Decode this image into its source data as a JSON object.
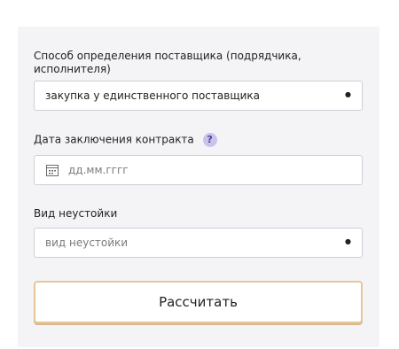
{
  "form": {
    "method_label": "Способ определения поставщика (подрядчика, исполнителя)",
    "method_value": "закупка у единственного поставщика",
    "date_label": "Дата заключения контракта",
    "date_help": "?",
    "date_placeholder": "дд.мм.гггг",
    "penalty_label": "Вид неустойки",
    "penalty_placeholder": "вид неустойки",
    "calculate_button": "Рассчитать"
  },
  "icons": {
    "help": "question-mark-circle",
    "calendar": "calendar-icon",
    "dropdown": "triangle-down"
  }
}
